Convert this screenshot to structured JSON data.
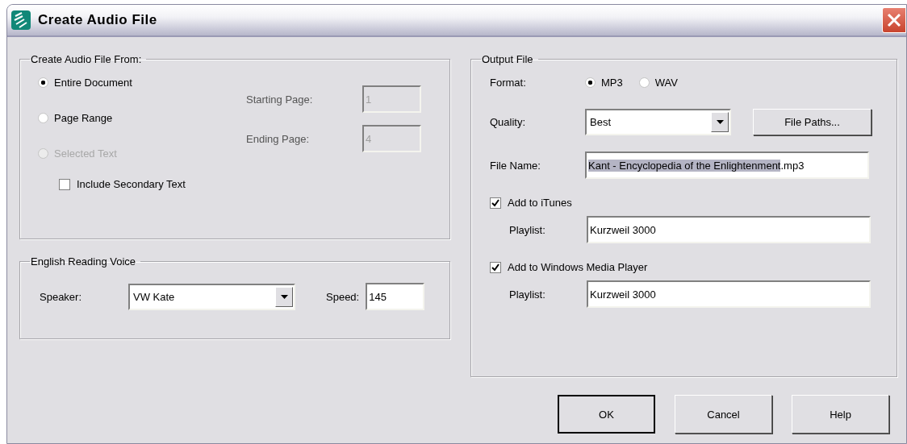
{
  "window": {
    "title": "Create Audio File"
  },
  "source": {
    "legend": "Create Audio File From:",
    "options": [
      {
        "label": "Entire Document",
        "selected": true,
        "disabled": false
      },
      {
        "label": "Page Range",
        "selected": false,
        "disabled": false
      },
      {
        "label": "Selected Text",
        "selected": false,
        "disabled": true
      }
    ],
    "pages": [
      {
        "label": "Starting Page:",
        "value": "1",
        "disabled": true
      },
      {
        "label": "Ending Page:",
        "value": "4",
        "disabled": true
      }
    ],
    "include_secondary": {
      "label": "Include Secondary Text",
      "checked": false
    }
  },
  "voice": {
    "legend": "English Reading Voice",
    "speaker": {
      "label": "Speaker:",
      "value": "VW Kate"
    },
    "speed": {
      "label": "Speed:",
      "value": "145"
    }
  },
  "output": {
    "legend": "Output File",
    "format": {
      "label": "Format:",
      "options": [
        {
          "label": "MP3",
          "selected": true
        },
        {
          "label": "WAV",
          "selected": false
        }
      ]
    },
    "quality": {
      "label": "Quality:",
      "value": "Best"
    },
    "file_paths_button": "File Paths...",
    "file_name": {
      "label": "File Name:",
      "selected_text": "Kant - Encyclopedia of the Enlightenment",
      "rest": ".mp3"
    },
    "targets": [
      {
        "label": "Add to iTunes",
        "checked": true,
        "playlist_label": "Playlist:",
        "playlist": "Kurzweil 3000"
      },
      {
        "label": "Add to Windows Media Player",
        "checked": true,
        "playlist_label": "Playlist:",
        "playlist": "Kurzweil 3000"
      }
    ]
  },
  "buttons": [
    {
      "label": "OK",
      "default": true
    },
    {
      "label": "Cancel",
      "default": false
    },
    {
      "label": "Help",
      "default": false
    }
  ]
}
